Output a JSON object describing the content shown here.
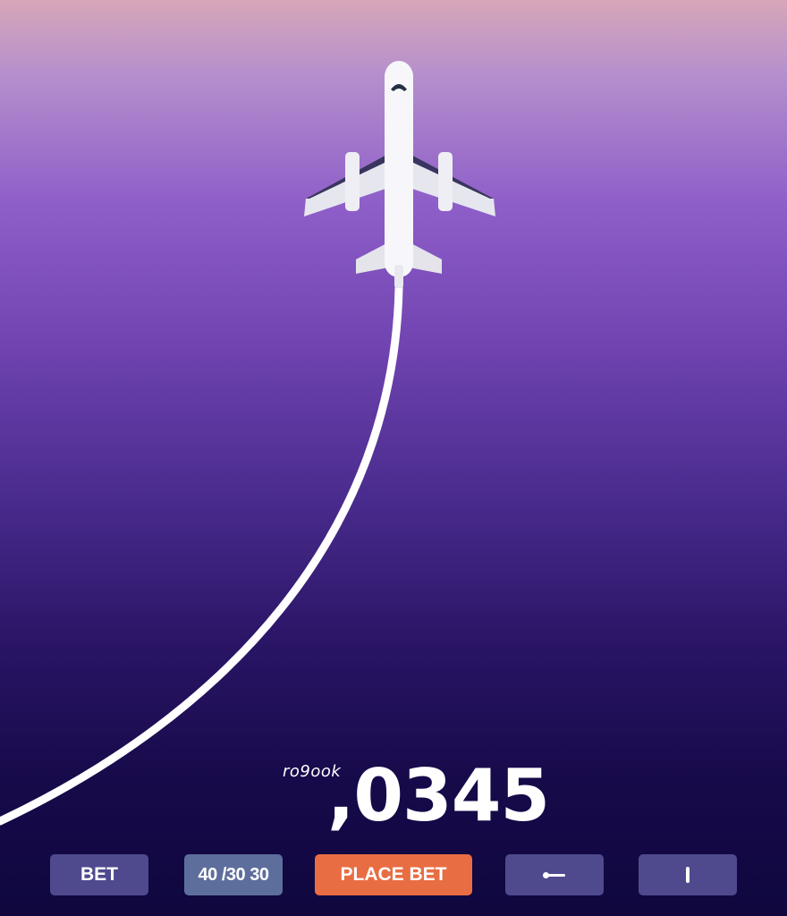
{
  "game": {
    "multiplier_prefix": "ro9ook",
    "multiplier_value": ",0345"
  },
  "controls": {
    "bet_label": "BET",
    "stake_value": "40 /30 30",
    "place_bet_label": "PLACE BET",
    "left_icon": "arrow-left-icon",
    "right_icon": "pause-bar-icon"
  },
  "colors": {
    "place_bet": "#e96d43",
    "secondary_button": "#4f4a8e",
    "stake_display": "#5e6e9c",
    "trail": "#ffffff"
  }
}
